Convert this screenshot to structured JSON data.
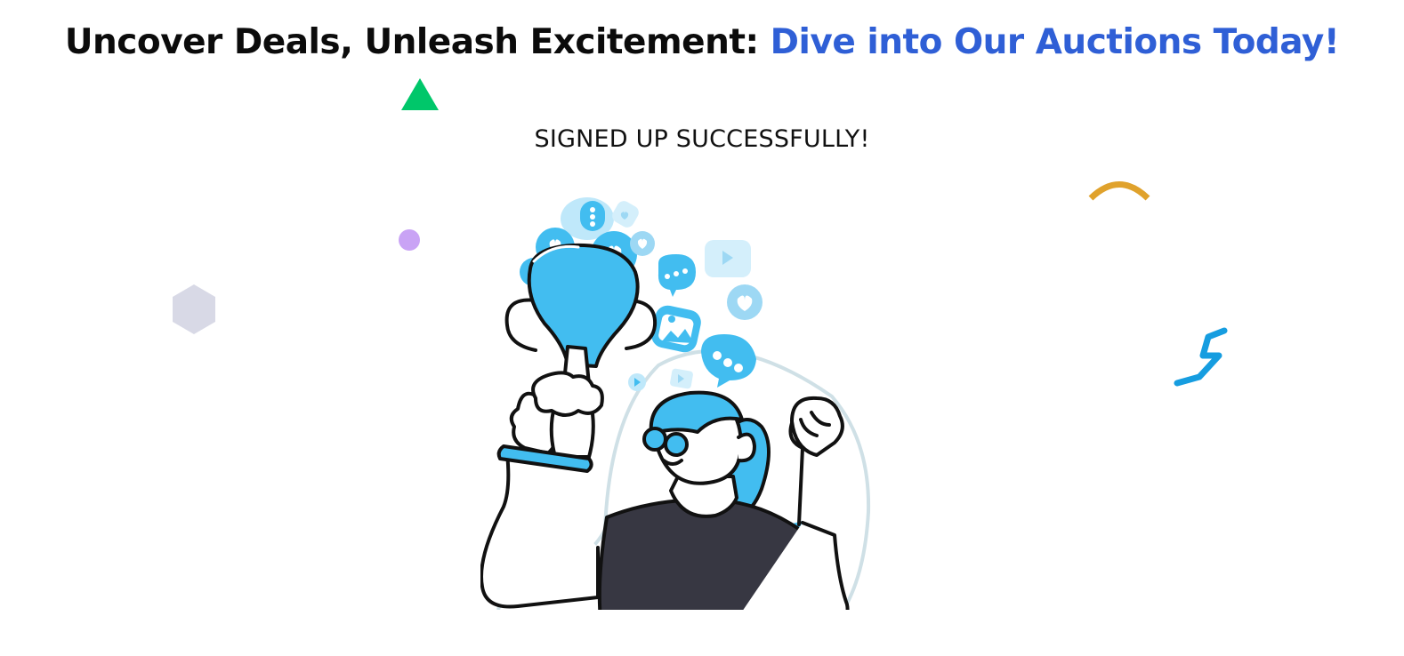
{
  "hero": {
    "title_part1": "Uncover Deals, Unleash Excitement: ",
    "title_part2": "Dive into Our Auctions Today!",
    "accent_color": "#2f5fd6"
  },
  "signup": {
    "status_text": "SIGNED UP SUCCESSFULLY!"
  },
  "decorations": {
    "triangle_color": "#00c76a",
    "circle_color": "#c9a3f5",
    "hexagon_color": "#d8d9e6",
    "arc_color": "#e0a22c",
    "zigzag_color": "#169de0"
  },
  "illustration": {
    "icon": "trophy-celebration-icon",
    "primary_color": "#42bdf0",
    "shirt_color": "#373742"
  }
}
